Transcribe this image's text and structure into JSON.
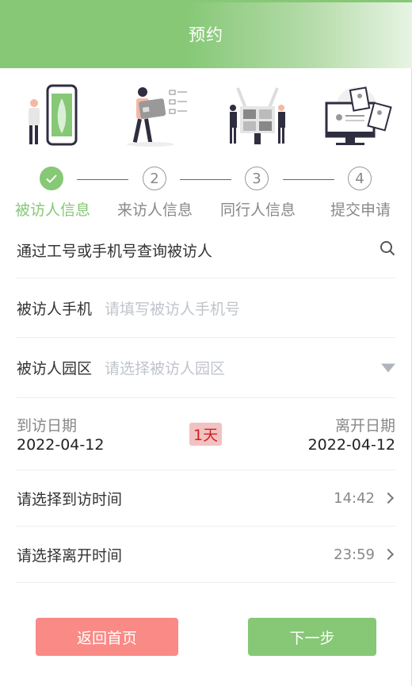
{
  "header": {
    "title": "预约"
  },
  "steps": [
    {
      "number": "",
      "label": "被访人信息",
      "state": "done"
    },
    {
      "number": "2",
      "label": "来访人信息",
      "state": "pending"
    },
    {
      "number": "3",
      "label": "同行人信息",
      "state": "pending"
    },
    {
      "number": "4",
      "label": "提交申请",
      "state": "pending"
    }
  ],
  "search": {
    "placeholder": "通过工号或手机号查询被访人",
    "icon": "search-icon"
  },
  "host_phone": {
    "label": "被访人手机",
    "placeholder": "请填写被访人手机号"
  },
  "host_park": {
    "label": "被访人园区",
    "placeholder": "请选择被访人园区",
    "icon": "triangle-down-icon"
  },
  "dates": {
    "arrive_label": "到访日期",
    "arrive_value": "2022-04-12",
    "duration": "1天",
    "leave_label": "离开日期",
    "leave_value": "2022-04-12"
  },
  "arrive_time": {
    "label": "请选择到访时间",
    "value": "14:42"
  },
  "leave_time": {
    "label": "请选择离开时间",
    "value": "23:59"
  },
  "buttons": {
    "home": "返回首页",
    "next": "下一步"
  },
  "colors": {
    "accent": "#86c876",
    "danger_button": "#f98a86",
    "badge_bg": "#f2c2c2",
    "badge_text": "#d32020"
  }
}
